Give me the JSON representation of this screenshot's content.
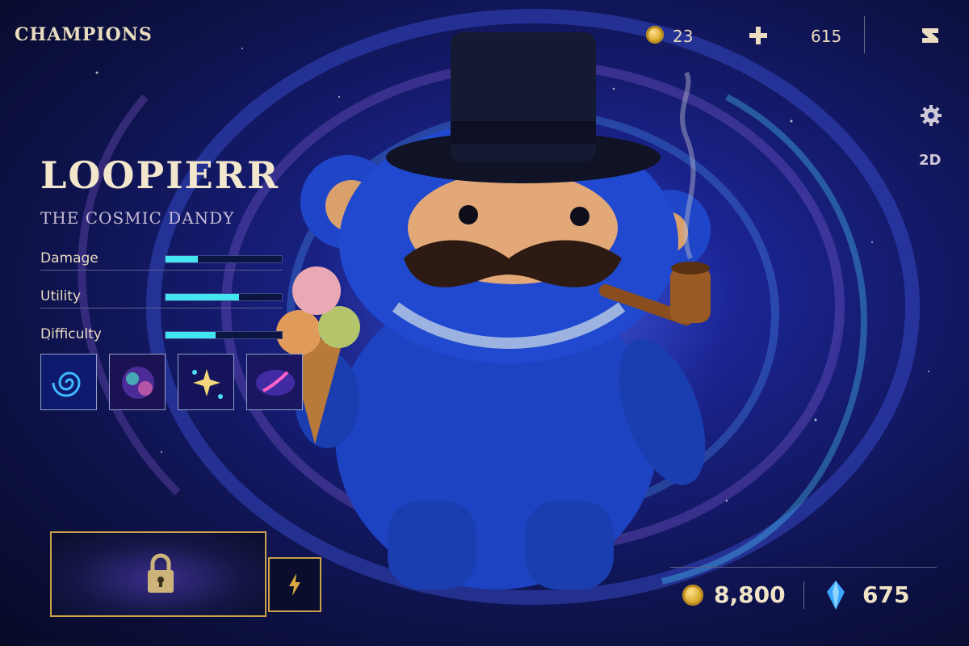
{
  "header": {
    "title": "CHAMPIONS",
    "coin_count": "23",
    "essence_count": "615",
    "icons": [
      "coin-icon",
      "plus-icon",
      "logo-icon"
    ]
  },
  "side_controls": {
    "settings_icon": "gear-icon",
    "view_toggle": "2D"
  },
  "champion": {
    "name": "LOOPIERR",
    "subtitle": "THE COSMIC DANDY",
    "stats": [
      {
        "label": "Damage",
        "level": 0.28
      },
      {
        "label": "Utility",
        "level": 0.63
      },
      {
        "label": "Difficulty",
        "level": 0.43
      }
    ],
    "abilities": [
      "spiral-galaxy-icon",
      "nebula-icon",
      "sparkle-star-icon",
      "comet-galaxy-icon"
    ]
  },
  "purchase": {
    "unlock_icon": "lock-icon",
    "quick_icon": "lightning-icon",
    "price_coins": "8,800",
    "price_gems": "675"
  },
  "colors": {
    "accent_gold": "#c8a14a",
    "stat_fill": "#43e6f0",
    "text_cream": "#e9dcc0"
  }
}
